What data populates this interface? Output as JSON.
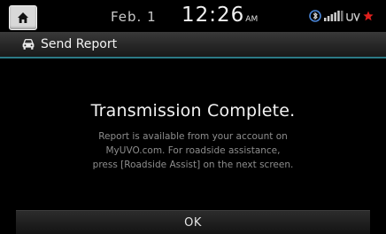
{
  "status_bar": {
    "home_icon": "home-icon",
    "date": "Feb.  1",
    "time": "12:26",
    "ampm": "AM",
    "icons": [
      "bluetooth-phone-icon",
      "signal-strength-icon",
      "uvo-icon",
      "red-star-icon"
    ],
    "star_color": "#e0201d"
  },
  "title_bar": {
    "icon": "car-report-icon",
    "title": "Send Report",
    "accent_color": "#2b7a86"
  },
  "dialog": {
    "headline": "Transmission Complete.",
    "lines": [
      "Report is available from your account on",
      "MyUVO.com. For roadside assistance,",
      "press [Roadside Assist] on the next screen."
    ]
  },
  "footer": {
    "ok_label": "OK"
  }
}
